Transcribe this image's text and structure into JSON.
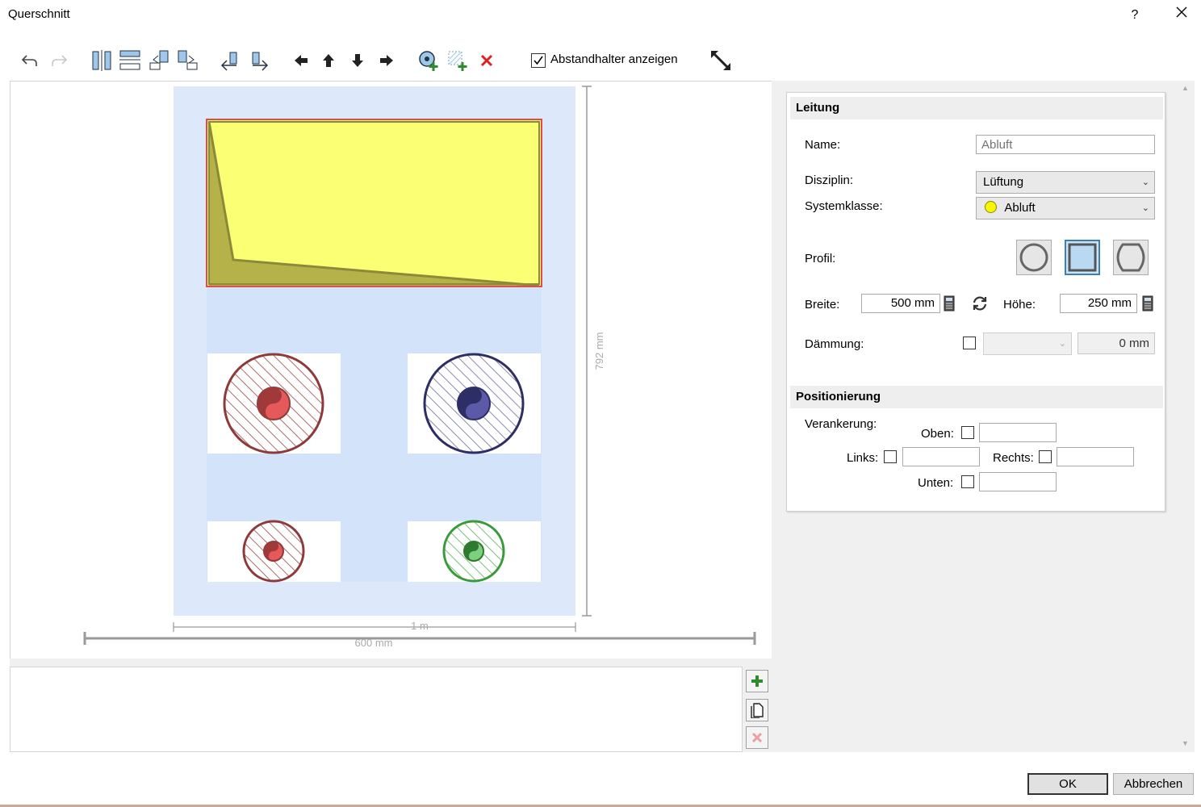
{
  "window": {
    "title": "Querschnitt",
    "help": "?",
    "close": "✕"
  },
  "toolbar": {
    "show_spacer_label": "Abstandhalter anzeigen",
    "show_spacer_checked": true
  },
  "canvas": {
    "dim_height": "792 mm",
    "dim_inner_width": "1 m",
    "dim_outer_width": "600 mm",
    "colors": {
      "background_zone": "#dde9fb",
      "duct_fill": "#fbff73",
      "duct_shadow": "#b6b24a",
      "duct_border": "#e34a4a",
      "red_pipe": "#a03a3a",
      "blue_pipe": "#3a3a7a",
      "green_pipe": "#3a9a3a"
    }
  },
  "panel": {
    "section_conduit": "Leitung",
    "name_label": "Name:",
    "name_placeholder": "Abluft",
    "discipline_label": "Disziplin:",
    "discipline_value": "Lüftung",
    "system_label": "Systemklasse:",
    "system_value": "Abluft",
    "system_color": "#f7f700",
    "profile_label": "Profil:",
    "width_label": "Breite:",
    "width_value": "500 mm",
    "height_label": "Höhe:",
    "height_value": "250 mm",
    "insulation_label": "Dämmung:",
    "insulation_value": "0 mm",
    "section_position": "Positionierung",
    "anchor_label": "Verankerung:",
    "top_label": "Oben:",
    "left_label": "Links:",
    "right_label": "Rechts:",
    "bottom_label": "Unten:"
  },
  "footer": {
    "ok": "OK",
    "cancel": "Abbrechen"
  }
}
